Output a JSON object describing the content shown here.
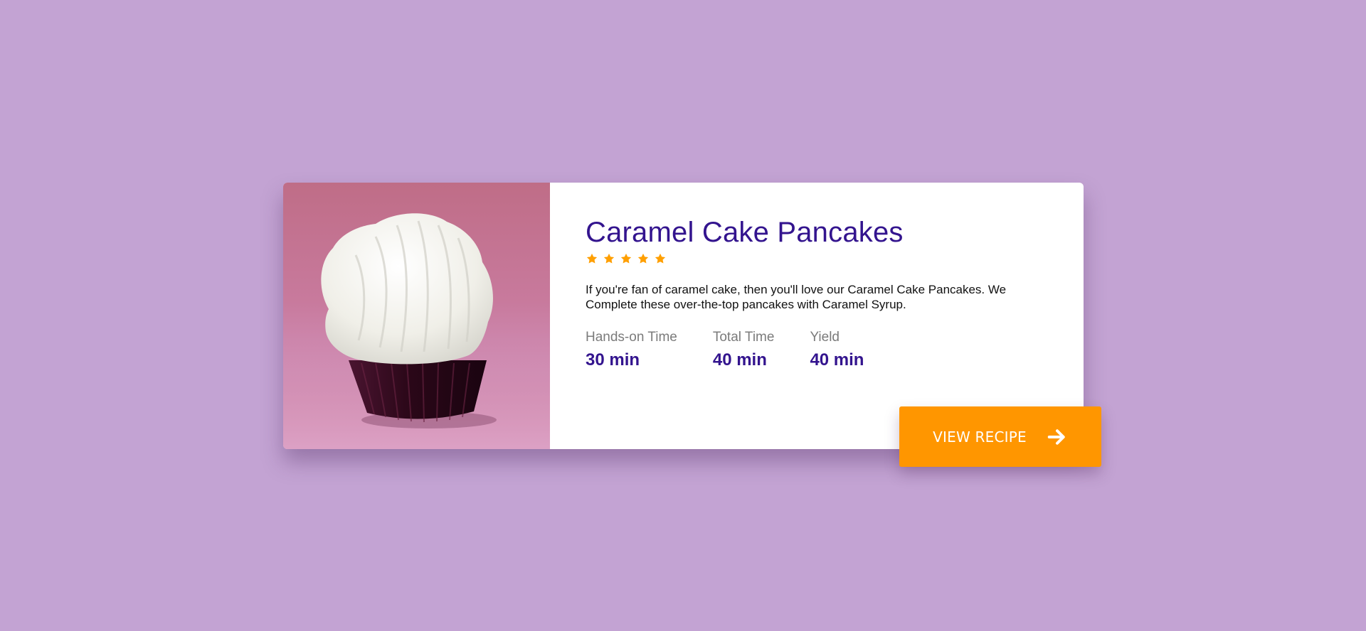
{
  "recipe": {
    "title": "Caramel Cake Pancakes",
    "rating": 5,
    "rating_max": 5,
    "description": "If you're fan of caramel cake, then you'll love our Caramel Cake Pancakes. We Complete these over-the-top pancakes with Caramel Syrup.",
    "stats": [
      {
        "label": "Hands-on Time",
        "value": "30 min"
      },
      {
        "label": "Total Time",
        "value": "40 min"
      },
      {
        "label": "Yield",
        "value": "40 min"
      }
    ],
    "button_label": "VIEW RECIPE",
    "button_icon": "arrow-right-icon",
    "photo_icon": "cupcake-photo"
  },
  "colors": {
    "background": "#c3a3d3",
    "title": "#33148e",
    "star": "#ff9f00",
    "button": "#ff9600",
    "label": "#7b7b7b"
  }
}
